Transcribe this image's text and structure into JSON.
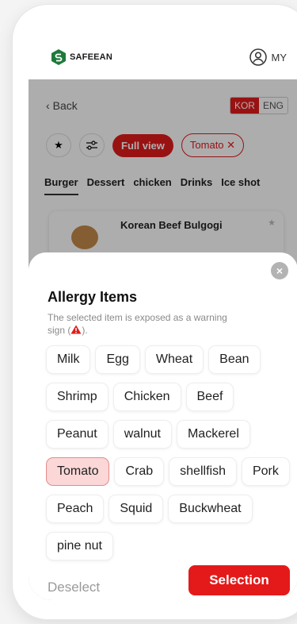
{
  "header": {
    "brand": "SAFEEAN",
    "my_label": "MY"
  },
  "page": {
    "back_label": "Back",
    "lang": {
      "kor": "KOR",
      "eng": "ENG"
    },
    "full_view_label": "Full view",
    "filter_tag_label": "Tomato ✕",
    "categories": [
      "Burger",
      "Dessert",
      "chicken",
      "Drinks",
      "Ice shot"
    ],
    "card_title": "Korean Beef Bulgogi"
  },
  "sheet": {
    "title": "Allergy Items",
    "desc_before": "The selected item is exposed as a warning sign (",
    "desc_after": ").",
    "items": [
      {
        "label": "Milk",
        "selected": false
      },
      {
        "label": "Egg",
        "selected": false
      },
      {
        "label": "Wheat",
        "selected": false
      },
      {
        "label": "Bean",
        "selected": false
      },
      {
        "label": "Shrimp",
        "selected": false
      },
      {
        "label": "Chicken",
        "selected": false
      },
      {
        "label": "Beef",
        "selected": false
      },
      {
        "label": "Peanut",
        "selected": false
      },
      {
        "label": "walnut",
        "selected": false
      },
      {
        "label": "Mackerel",
        "selected": false
      },
      {
        "label": "Tomato",
        "selected": true
      },
      {
        "label": "Crab",
        "selected": false
      },
      {
        "label": "shellfish",
        "selected": false
      },
      {
        "label": "Pork",
        "selected": false
      },
      {
        "label": "Peach",
        "selected": false
      },
      {
        "label": "Squid",
        "selected": false
      },
      {
        "label": "Buckwheat",
        "selected": false
      },
      {
        "label": "pine nut",
        "selected": false
      }
    ],
    "deselect_label": "Deselect",
    "selection_label": "Selection"
  },
  "colors": {
    "accent": "#e41a1a",
    "selected_chip": "#fbd7d7",
    "brand_green": "#1f7a3a"
  }
}
